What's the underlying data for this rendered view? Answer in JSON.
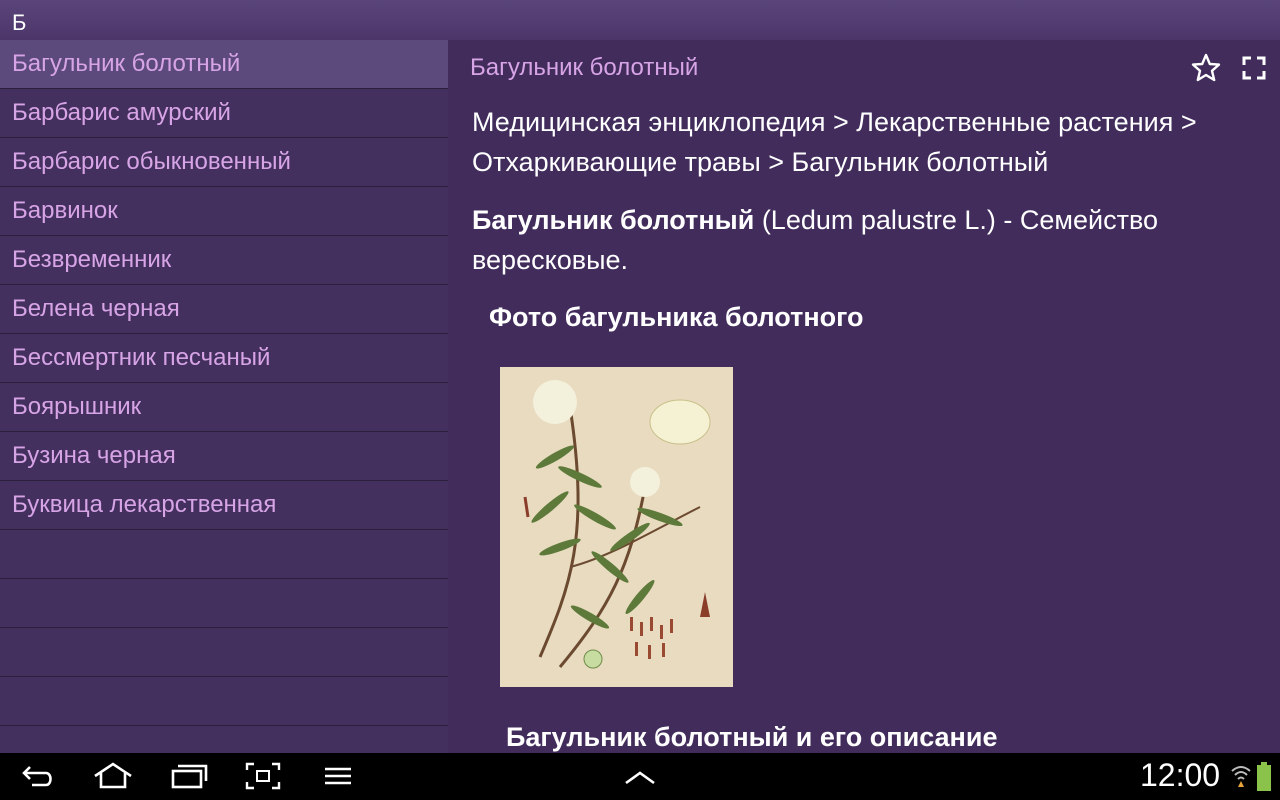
{
  "topbar": {
    "letter": "Б"
  },
  "sidebar": {
    "items": [
      {
        "label": "Багульник болотный"
      },
      {
        "label": "Барбарис амурский"
      },
      {
        "label": "Барбарис обыкновенный"
      },
      {
        "label": "Барвинок"
      },
      {
        "label": "Безвременник"
      },
      {
        "label": "Белена черная"
      },
      {
        "label": "Бессмертник песчаный"
      },
      {
        "label": "Боярышник"
      },
      {
        "label": "Бузина черная"
      },
      {
        "label": "Буквица лекарственная"
      }
    ]
  },
  "main": {
    "title": "Багульник болотный",
    "breadcrumb_line1": "Медицинская энциклопедия > Лекарственные растения >",
    "breadcrumb_line2": "Отхаркивающие травы > Багульник болотный",
    "desc_bold": "Багульник болотный",
    "desc_rest": " (Ledum palustre L.) - Семейство вересковые.",
    "photo_heading": "Фото багульника болотного",
    "section_heading": "Багульник болотный и его описание",
    "icons": [
      "star-icon",
      "fullscreen-icon"
    ]
  },
  "navbar": {
    "time": "12:00",
    "icons": [
      "back-icon",
      "home-icon",
      "recent-apps-icon",
      "screenshot-icon",
      "menu-icon",
      "up-arrow-icon",
      "wifi-icon",
      "battery-icon"
    ]
  },
  "colors": {
    "background": "#412c5c",
    "list_text": "#d7a4e6",
    "selected_item": "#5d4a7c",
    "battery": "#8bc34a"
  }
}
